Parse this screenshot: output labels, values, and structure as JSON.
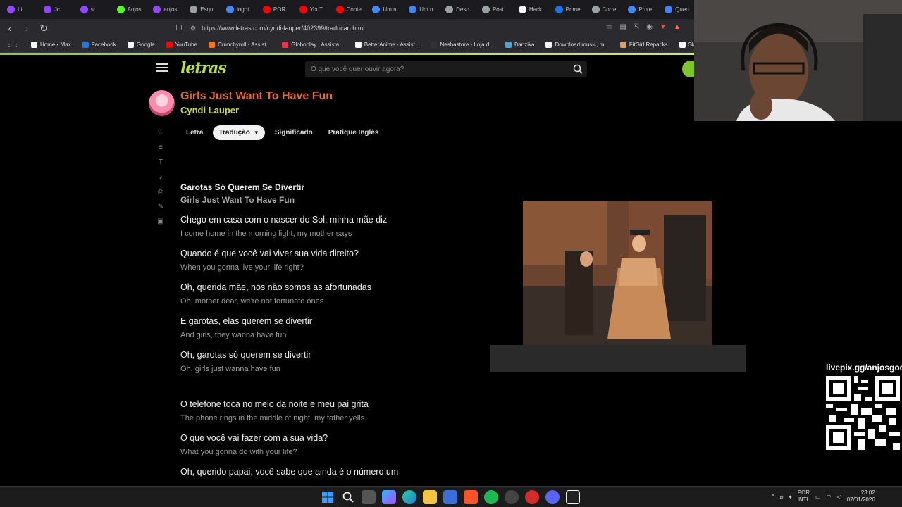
{
  "browser": {
    "tabs": [
      {
        "label": "Li",
        "color": "#9146ff"
      },
      {
        "label": "Jc",
        "color": "#9146ff"
      },
      {
        "label": "sł",
        "color": "#9146ff"
      },
      {
        "label": "Anjos",
        "color": "#53fc18"
      },
      {
        "label": "anjos",
        "color": "#9146ff"
      },
      {
        "label": "Esqu",
        "color": "#9aa0a6"
      },
      {
        "label": "logot",
        "color": "#4285f4"
      },
      {
        "label": "POR",
        "color": "#ff0000"
      },
      {
        "label": "YouT",
        "color": "#ff0000"
      },
      {
        "label": "Conte",
        "color": "#ff0000"
      },
      {
        "label": "Um n",
        "color": "#4285f4"
      },
      {
        "label": "Um n",
        "color": "#4285f4"
      },
      {
        "label": "Desc",
        "color": "#9aa0a6"
      },
      {
        "label": "Post",
        "color": "#9aa0a6"
      },
      {
        "label": "Hack",
        "color": "#ffffff"
      },
      {
        "label": "Prime",
        "color": "#1a73e8"
      },
      {
        "label": "Corre",
        "color": "#9aa0a6"
      },
      {
        "label": "Proje",
        "color": "#4285f4"
      },
      {
        "label": "Queo",
        "color": "#4285f4"
      }
    ],
    "url": "https://www.letras.com/cyndi-lauper/402399/traducao.html",
    "bookmarks": [
      {
        "label": "Home • Max",
        "color": "#ffffff"
      },
      {
        "label": "Facebook",
        "color": "#1877f2"
      },
      {
        "label": "Google",
        "color": "#ffffff"
      },
      {
        "label": "YouTube",
        "color": "#ff0000"
      },
      {
        "label": "Crunchyroll - Assist...",
        "color": "#f47521"
      },
      {
        "label": "Globoplay | Assista...",
        "color": "#e8334a"
      },
      {
        "label": "BetterAnime - Assist...",
        "color": "#ffffff"
      },
      {
        "label": "Neshastore - Loja d...",
        "color": "#333333"
      },
      {
        "label": "Banzika",
        "color": "#4aa3df"
      },
      {
        "label": "Download music, m...",
        "color": "#ffffff"
      },
      {
        "label": "FitGirl Repacks",
        "color": "#d4a373"
      },
      {
        "label": "Skidrow & Relo",
        "color": "#ffffff"
      }
    ]
  },
  "site": {
    "logo": "letras",
    "search_placeholder": "O que você quer ouvir agora?",
    "accent": "#b8e03a"
  },
  "song": {
    "title": "Girls Just Want To Have Fun",
    "artist": "Cyndi Lauper",
    "tabs": [
      {
        "label": "Letra",
        "active": false
      },
      {
        "label": "Tradução",
        "active": true
      },
      {
        "label": "Significado",
        "active": false
      },
      {
        "label": "Pratique Inglês",
        "active": false
      }
    ]
  },
  "lyrics": {
    "title_pt": "Garotas Só Querem Se Divertir",
    "title_en": "Girls Just Want To Have Fun",
    "stanza1": [
      {
        "pt": "Chego em casa com o nascer do Sol, minha mãe diz",
        "en": "I come home in the morning light, my mother says"
      },
      {
        "pt": "Quando é que você vai viver sua vida direito?",
        "en": "When you gonna live your life right?"
      },
      {
        "pt": "Oh, querida mãe, nós não somos as afortunadas",
        "en": "Oh, mother dear, we're not fortunate ones"
      },
      {
        "pt": "E garotas, elas querem se divertir",
        "en": "And girls, they wanna have fun"
      },
      {
        "pt": "Oh, garotas só querem se divertir",
        "en": "Oh, girls just wanna have fun"
      }
    ],
    "stanza2": [
      {
        "pt": "O telefone toca no meio da noite e meu pai grita",
        "en": "The phone rings in the middle of night, my father yells"
      },
      {
        "pt": "O que você vai fazer com a sua vida?",
        "en": "What you gonna do with your life?"
      },
      {
        "pt": "Oh, querido papai, você sabe que ainda é o número um",
        "en": ""
      }
    ]
  },
  "overlay": {
    "qr_label": "livepix.gg/anjosgod"
  },
  "taskbar": {
    "lang_top": "POR",
    "lang_bottom": "INTL",
    "time": "23:02",
    "date": "07/01/2026"
  }
}
